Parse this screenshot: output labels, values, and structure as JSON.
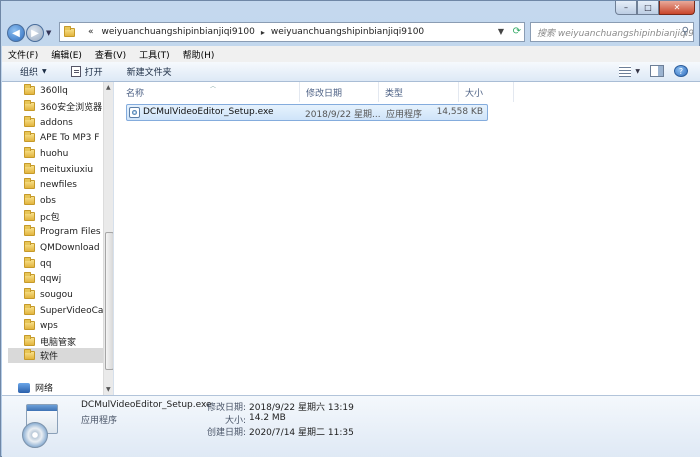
{
  "window": {
    "caption_buttons": [
      "–",
      "□",
      "✕"
    ]
  },
  "address_bar": {
    "overflow": "«",
    "segments": [
      "weiyuanchuangshipinbianjiqi9100",
      "weiyuanchuangshipinbianjiqi9100"
    ],
    "separator": "▸"
  },
  "search": {
    "placeholder": "搜索 weiyuanchuangshipinbianjiqi9..."
  },
  "menu": [
    "文件(F)",
    "编辑(E)",
    "查看(V)",
    "工具(T)",
    "帮助(H)"
  ],
  "toolbar": {
    "organize": "组织",
    "open": "打开",
    "new_folder": "新建文件夹"
  },
  "nav_tree": {
    "items": [
      "360llq",
      "360安全浏览器",
      "addons",
      "APE To MP3 F",
      "huohu",
      "meituxiuxiu",
      "newfiles",
      "obs",
      "pc包",
      "Program Files",
      "QMDownload",
      "qq",
      "qqwj",
      "sougou",
      "SuperVideoCa",
      "wps",
      "电脑管家",
      "软件"
    ],
    "selected": "软件",
    "network": "网络"
  },
  "columns": [
    "名称",
    "修改日期",
    "类型",
    "大小"
  ],
  "files": [
    {
      "name": "DCMulVideoEditor_Setup.exe",
      "date": "2018/9/22 星期...",
      "type": "应用程序",
      "size": "14,558 KB"
    }
  ],
  "details": {
    "name": "DCMulVideoEditor_Setup.exe",
    "type": "应用程序",
    "modified_label": "修改日期:",
    "modified_value": "2018/9/22 星期六 13:19",
    "size_label": "大小:",
    "size_value": "14.2 MB",
    "created_label": "创建日期:",
    "created_value": "2020/7/14 星期二 11:35"
  }
}
